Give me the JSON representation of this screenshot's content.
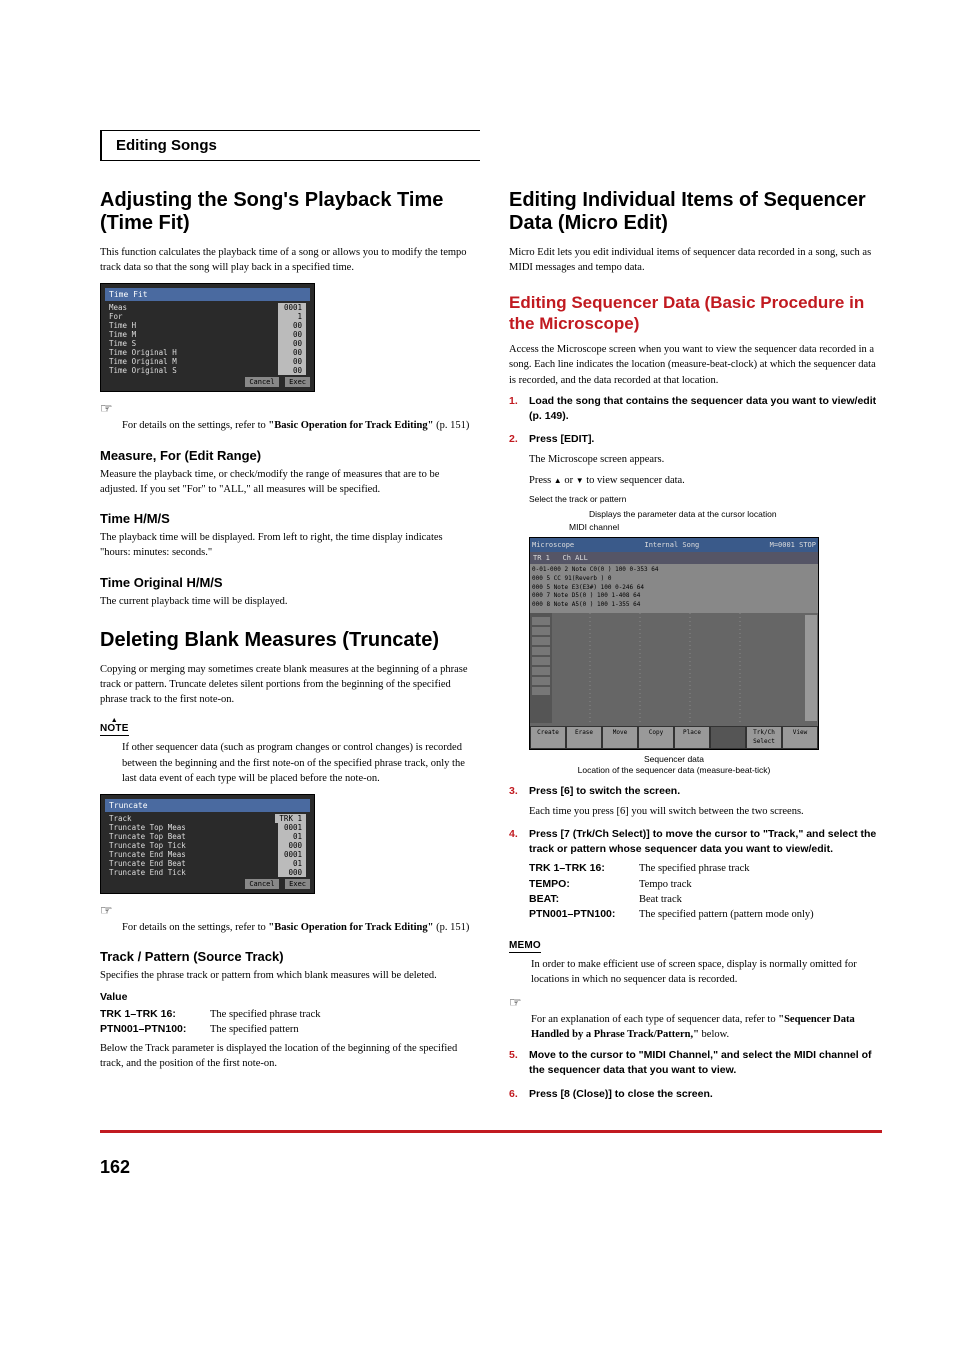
{
  "sectionHeader": "Editing Songs",
  "pageNumber": "162",
  "left": {
    "h1": "Adjusting the Song's Playback Time (Time Fit)",
    "p1": "This function calculates the playback time of a song or allows you to modify the tempo track data so that the song will play back in a specified time.",
    "shot1": {
      "title": "Time Fit",
      "rows": [
        [
          "Meas",
          "0001"
        ],
        [
          "For",
          "1"
        ],
        [
          "Time H",
          "00"
        ],
        [
          "Time M",
          "00"
        ],
        [
          "Time S",
          "00"
        ],
        [
          "Time Original H",
          "00"
        ],
        [
          "Time Original M",
          "00"
        ],
        [
          "Time Original S",
          "00"
        ]
      ],
      "btns": [
        "Cancel",
        "Exec"
      ]
    },
    "ref1a": "For details on the settings, refer to ",
    "ref1b": "\"Basic Operation for Track Editing\"",
    "ref1c": " (p. 151)",
    "h3a": "Measure, For (Edit Range)",
    "h3a_p": "Measure the playback time, or check/modify the range of measures that are to be adjusted. If you set \"For\" to \"ALL,\" all measures will be specified.",
    "h3b": "Time H/M/S",
    "h3b_p": "The playback time will be displayed. From left to right, the time display indicates \"hours: minutes: seconds.\"",
    "h3c": "Time Original H/M/S",
    "h3c_p": "The current playback time will be displayed.",
    "h1b": "Deleting Blank Measures (Truncate)",
    "h1b_p": "Copying or merging may sometimes create blank measures at the beginning of a phrase track or pattern. Truncate deletes silent portions from the beginning of the specified phrase track to the first note-on.",
    "noteLabel": "NOTE",
    "note_p": "If other sequencer data (such as program changes or control changes) is recorded between the beginning and the first note-on of the specified phrase track, only the last data event of each type will be placed before the note-on.",
    "shot2": {
      "title": "Truncate",
      "rows": [
        [
          "Track",
          "TRK 1"
        ],
        [
          "Truncate Top Meas",
          "0001"
        ],
        [
          "Truncate Top Beat",
          "01"
        ],
        [
          "Truncate Top Tick",
          "000"
        ],
        [
          "Truncate End Meas",
          "0001"
        ],
        [
          "Truncate End Beat",
          "01"
        ],
        [
          "Truncate End Tick",
          "000"
        ]
      ],
      "btns": [
        "Cancel",
        "Exec"
      ]
    },
    "ref2a": "For details on the settings, refer to ",
    "ref2b": "\"Basic Operation for Track Editing\"",
    "ref2c": " (p. 151)",
    "h3d": "Track / Pattern (Source Track)",
    "h3d_p": "Specifies the phrase track or pattern from which blank measures will be deleted.",
    "valueLabel": "Value",
    "kv1": {
      "k": "TRK 1–TRK 16:",
      "v": "The specified phrase track"
    },
    "kv2": {
      "k": "PTN001–PTN100:",
      "v": "The specified pattern"
    },
    "below_p": "Below the Track parameter is displayed the location of the beginning of the specified track, and the position of the first note-on."
  },
  "right": {
    "h1": "Editing Individual Items of Sequencer Data (Micro Edit)",
    "p1": "Micro Edit lets you edit individual items of sequencer data recorded in a song, such as MIDI messages and tempo data.",
    "h2": "Editing Sequencer Data (Basic Procedure in the Microscope)",
    "p2": "Access the Microscope screen when you want to view the sequencer data recorded in a song. Each line indicates the location (measure-beat-clock) at which the sequencer data is recorded, and the data recorded at that location.",
    "step1": "Load the song that contains the sequencer data you want to view/edit (p. 149).",
    "step2": "Press [EDIT].",
    "step2_p1": "The Microscope screen appears.",
    "step2_p2a": "Press ",
    "step2_p2b": " or ",
    "step2_p2c": " to view sequencer data.",
    "anno": {
      "sel": "Select the track or pattern",
      "midi": "MIDI channel",
      "param": "Displays the parameter data at the cursor location",
      "seq": "Sequencer data",
      "loc": "Location of the sequencer data (measure-beat-tick)"
    },
    "bigshot": {
      "title": "Microscope",
      "internalSong": "Internal Song",
      "meas": "M=0001",
      "stop": "STOP",
      "trk": "TR 1",
      "ch": "Ch ALL",
      "events": [
        "0-01-000  2 Note   C0(0  ) 100     0-353  64",
        "     000  5 CC     91(Reverb  )     0",
        "     000  5 Note   E3(E3#) 100     0-246  64",
        "     000  7 Note   D5(0  ) 100     1-408  64",
        "     000  8 Note   A5(0  ) 100     1-355  64"
      ],
      "btns": [
        "Create",
        "Erase",
        "Move",
        "Copy",
        "Place",
        "",
        "Trk/Ch Select",
        "View"
      ]
    },
    "step3": "Press [6] to switch the screen.",
    "step3_p": "Each time you press [6] you will switch between the two screens.",
    "step4": "Press [7 (Trk/Ch Select)] to move the cursor to \"Track,\" and select the track or pattern whose sequencer data you want to view/edit.",
    "kv1": {
      "k": "TRK 1–TRK 16:",
      "v": "The specified phrase track"
    },
    "kv2": {
      "k": "TEMPO:",
      "v": "Tempo track"
    },
    "kv3": {
      "k": "BEAT:",
      "v": "Beat track"
    },
    "kv4": {
      "k": "PTN001–PTN100:",
      "v": "The specified pattern (pattern mode only)"
    },
    "memoLabel": "MEMO",
    "memo_p": "In order to make efficient use of screen space, display is normally omitted for locations in which no sequencer data is recorded.",
    "ref_a": "For an explanation of each type of sequencer data, refer to ",
    "ref_b": "\"Sequencer Data Handled by a Phrase Track/Pattern,\"",
    "ref_c": " below.",
    "step5": "Move to the cursor to \"MIDI Channel,\" and select the MIDI channel of the sequencer data that you want to view.",
    "step6": "Press [8 (Close)] to close the screen."
  }
}
